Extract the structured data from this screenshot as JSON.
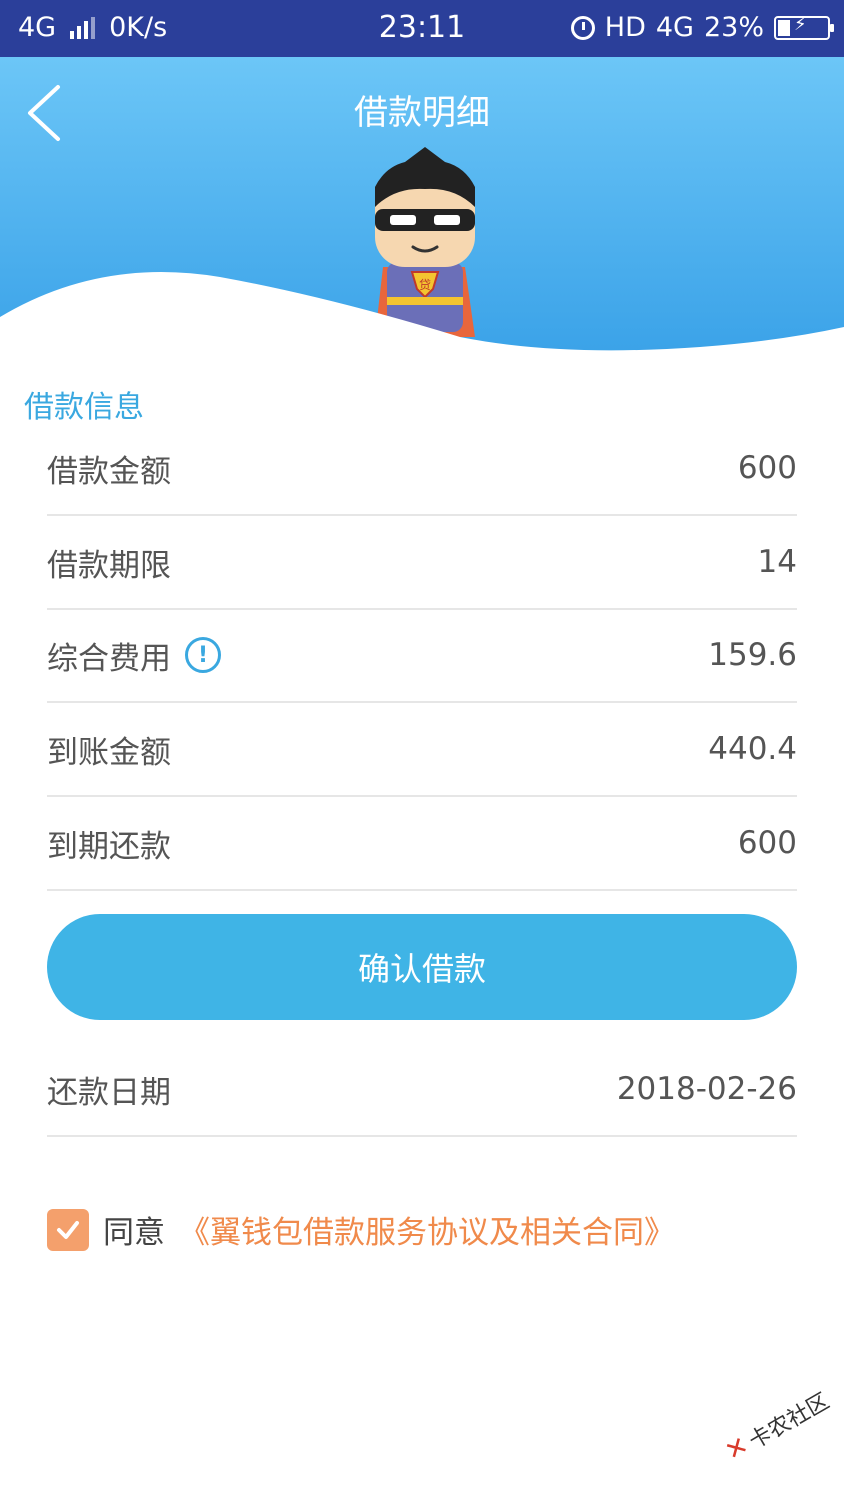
{
  "status_bar": {
    "network": "4G",
    "speed": "0K/s",
    "time": "23:11",
    "hd": "HD",
    "network_right": "4G",
    "battery": "23%"
  },
  "header": {
    "title": "借款明细"
  },
  "section": {
    "title": "借款信息"
  },
  "rows": [
    {
      "label": "借款金额",
      "value": "600"
    },
    {
      "label": "借款期限",
      "value": "14"
    },
    {
      "label": "综合费用",
      "value": "159.6"
    },
    {
      "label": "到账金额",
      "value": "440.4"
    },
    {
      "label": "到期还款",
      "value": "600"
    }
  ],
  "confirm_button": "确认借款",
  "repay_date": {
    "label": "还款日期",
    "value": "2018-02-26"
  },
  "agreement": {
    "prefix": "同意",
    "link": "《翼钱包借款服务协议及相关合同》",
    "checked": true
  },
  "watermark": {
    "text": "卡农社区"
  },
  "colors": {
    "status_bar": "#2b3f9a",
    "header_top": "#6cc6f7",
    "accent": "#3aa8e0",
    "button": "#3fb4e6",
    "link": "#f08a4b"
  }
}
